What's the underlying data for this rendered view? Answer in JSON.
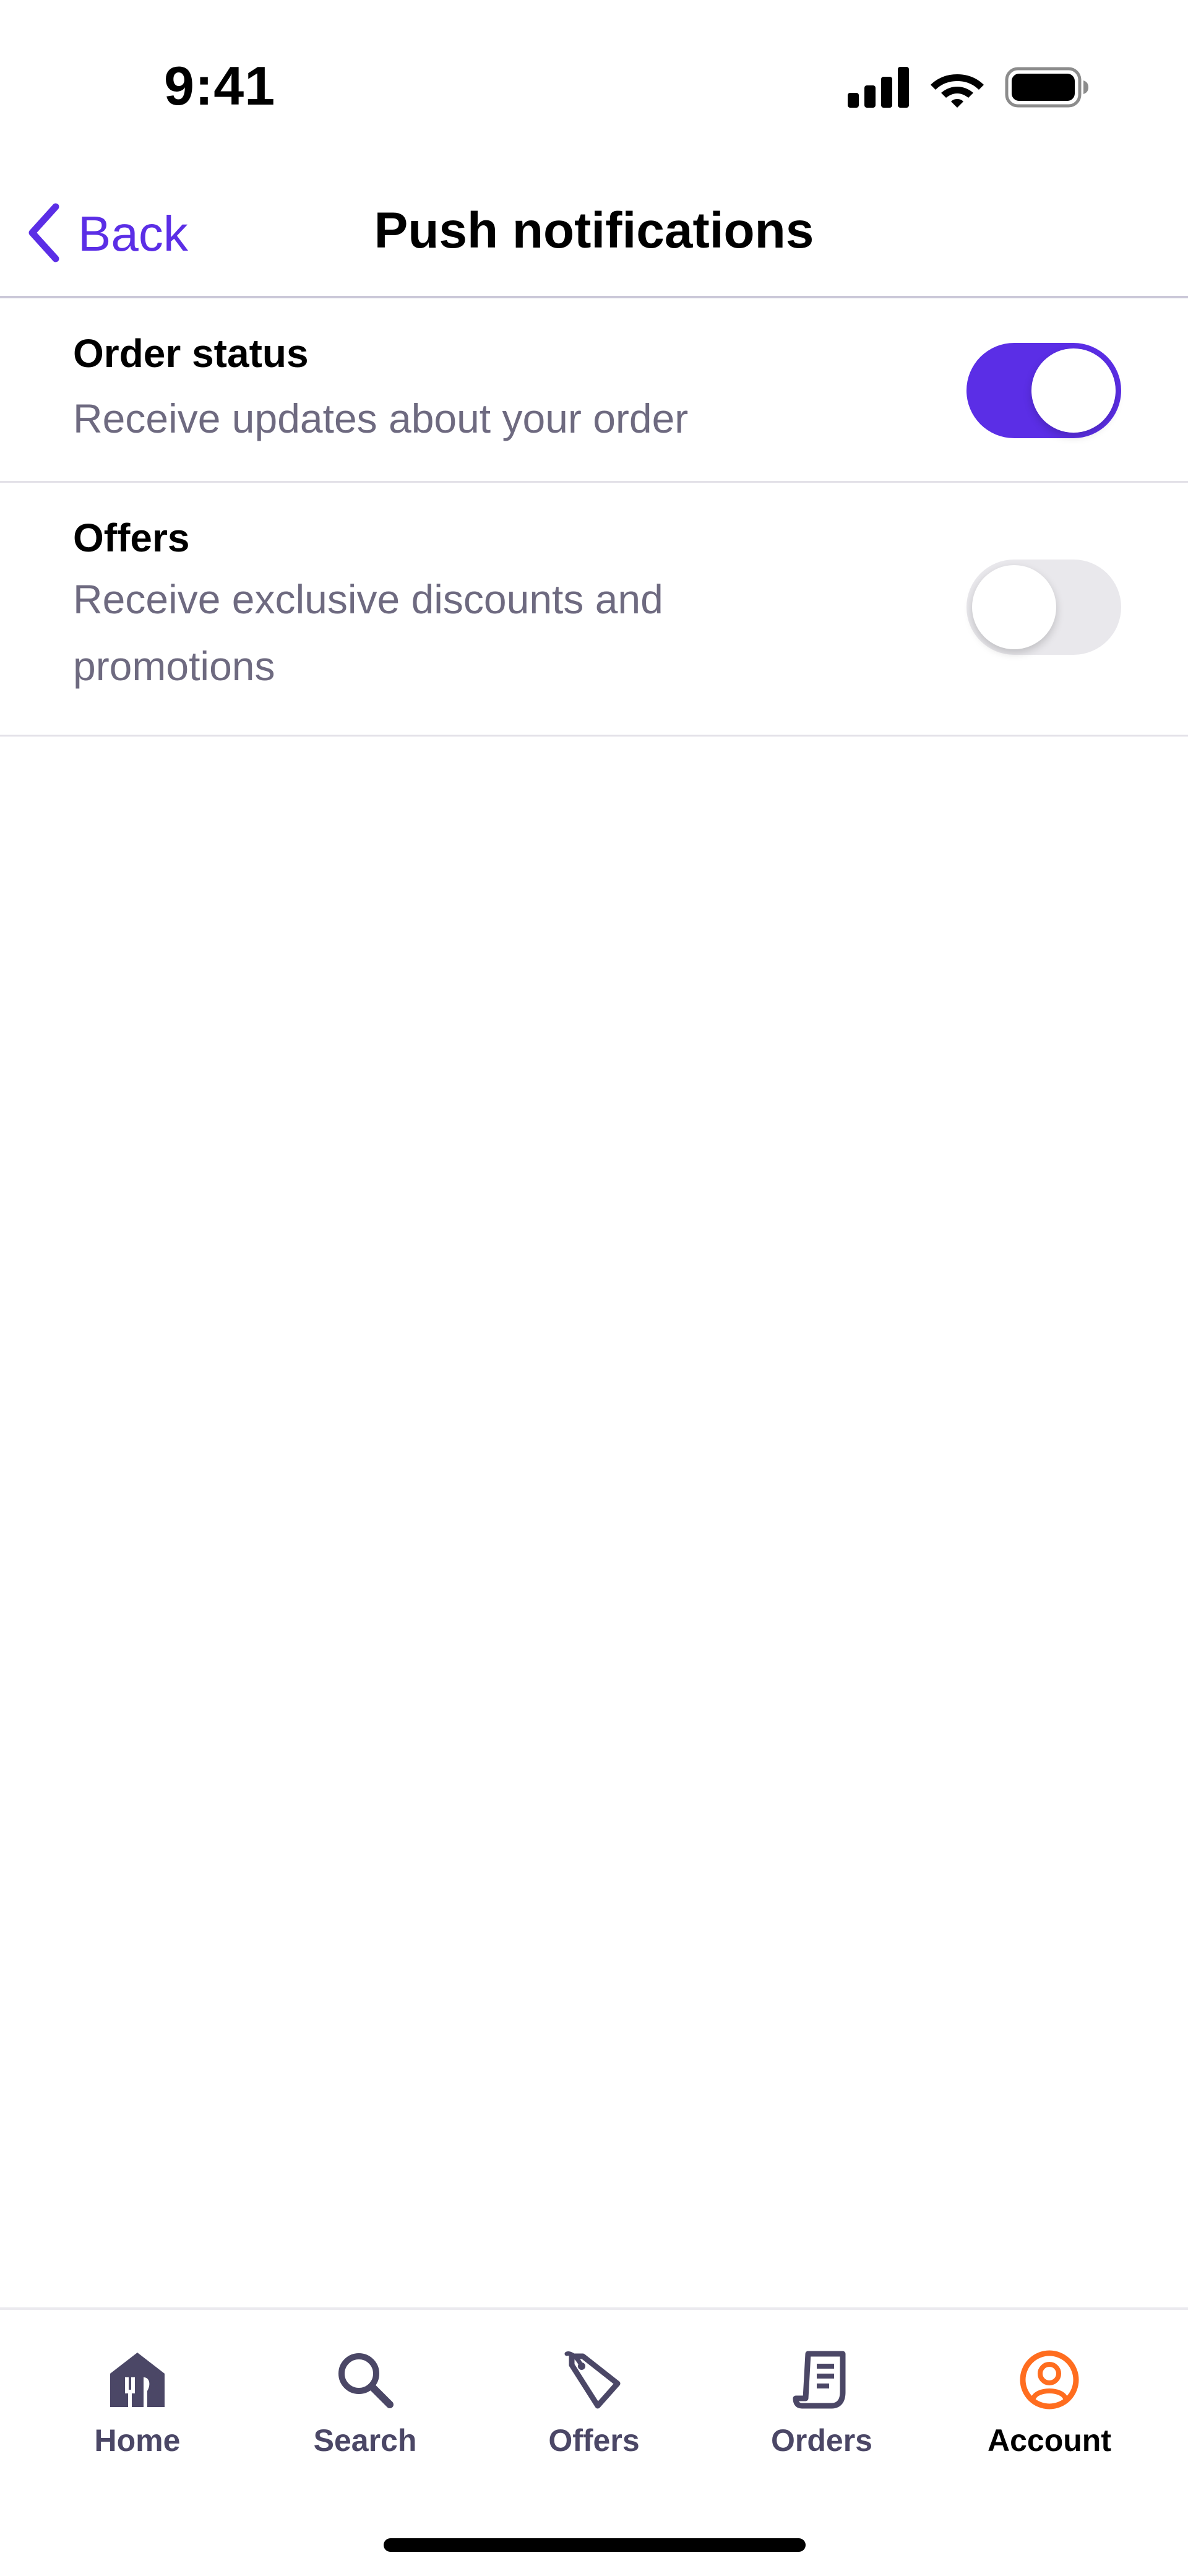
{
  "status_bar": {
    "time": "9:41",
    "icons": [
      "cellular-signal-icon",
      "wifi-icon",
      "battery-icon"
    ]
  },
  "header": {
    "back_label": "Back",
    "title": "Push notifications"
  },
  "settings": [
    {
      "title": "Order status",
      "description": "Receive updates about your order",
      "enabled": true
    },
    {
      "title": "Offers",
      "description": "Receive exclusive discounts and promotions",
      "enabled": false
    }
  ],
  "tab_bar": {
    "items": [
      {
        "label": "Home",
        "icon": "home-icon",
        "active": false
      },
      {
        "label": "Search",
        "icon": "search-icon",
        "active": false
      },
      {
        "label": "Offers",
        "icon": "tag-icon",
        "active": false
      },
      {
        "label": "Orders",
        "icon": "receipt-icon",
        "active": false
      },
      {
        "label": "Account",
        "icon": "account-icon",
        "active": true
      }
    ]
  },
  "colors": {
    "accent": "#5b2ee6",
    "active_tab": "#ff6d1f",
    "tab_inactive": "#4b4766",
    "secondary_text": "#6e6a80"
  }
}
